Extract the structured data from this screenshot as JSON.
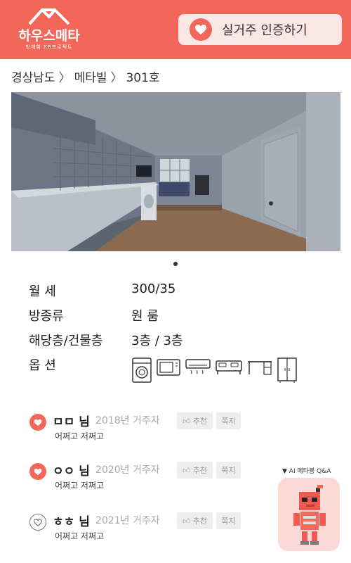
{
  "header": {
    "logo_title": "하우스메타",
    "logo_subtitle": "방체험 XR프로젝트",
    "verify_button": "실거주 인증하기",
    "accent_color": "#f2675a"
  },
  "breadcrumb": [
    "경상남도",
    "메타빌",
    "301호"
  ],
  "breadcrumb_separator": "〉",
  "details": [
    {
      "key": "월 세",
      "value": "300/35"
    },
    {
      "key": "방종류",
      "value": "원 룸"
    },
    {
      "key": "해당층/건물층",
      "value": "3층 / 3층"
    },
    {
      "key": "옵 션",
      "value": ""
    }
  ],
  "options_icons": [
    "washing-machine-icon",
    "microwave-icon",
    "air-conditioner-icon",
    "bed-icon",
    "desk-icon",
    "wardrobe-icon"
  ],
  "reviews": [
    {
      "name": "ㅁㅁ 님",
      "year": "2018년 거주자",
      "text": "어쩌고 저쩌고",
      "recommend": "추천",
      "message": "쪽지",
      "liked": true
    },
    {
      "name": "ㅇㅇ 님",
      "year": "2020년 거주자",
      "text": "어쩌고 저쩌고",
      "recommend": "추천",
      "message": "쪽지",
      "liked": true
    },
    {
      "name": "ㅎㅎ 님",
      "year": "2021년 거주자",
      "text": "어쩌고 저쩌고",
      "recommend": "추천",
      "message": "쪽지",
      "liked": false
    }
  ],
  "ai_helper": {
    "label": "▼ AI 메타봉 Q&A"
  }
}
